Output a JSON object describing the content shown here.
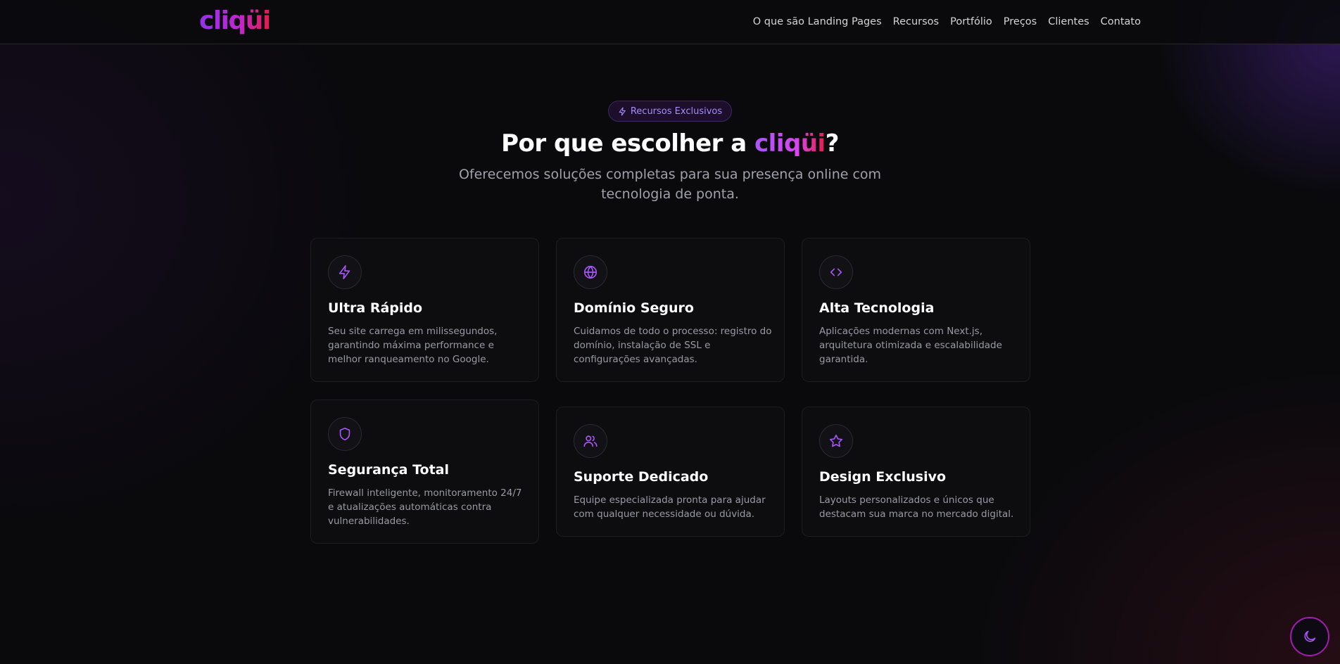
{
  "header": {
    "logo": "cliqüi",
    "nav": [
      "O que são Landing Pages",
      "Recursos",
      "Portfólio",
      "Preços",
      "Clientes",
      "Contato"
    ]
  },
  "hero": {
    "badge": "Recursos Exclusivos",
    "title_prefix": "Por que escolher a ",
    "title_brand": "cliqüi",
    "title_suffix": "?",
    "subtitle": "Oferecemos soluções completas para sua presença online com tecnologia de ponta."
  },
  "features": [
    {
      "icon": "lightning-icon",
      "title": "Ultra Rápido",
      "description": "Seu site carrega em milissegundos, garantindo máxima performance e melhor ranqueamento no Google."
    },
    {
      "icon": "globe-icon",
      "title": "Domínio Seguro",
      "description": "Cuidamos de todo o processo: registro do domínio, instalação de SSL e configurações avançadas."
    },
    {
      "icon": "code-icon",
      "title": "Alta Tecnologia",
      "description": "Aplicações modernas com Next.js, arquitetura otimizada e escalabilidade garantida."
    },
    {
      "icon": "shield-icon",
      "title": "Segurança Total",
      "description": "Firewall inteligente, monitoramento 24/7 e atualizações automáticas contra vulnerabilidades."
    },
    {
      "icon": "users-icon",
      "title": "Suporte Dedicado",
      "description": "Equipe especializada pronta para ajudar com qualquer necessidade ou dúvida."
    },
    {
      "icon": "star-icon",
      "title": "Design Exclusivo",
      "description": "Layouts personalizados e únicos que destacam sua marca no mercado digital."
    }
  ],
  "theme_toggle": {
    "icon": "moon-icon"
  },
  "colors": {
    "accent": "#a855f7",
    "brand_gradient_start": "#9333ea",
    "brand_gradient_end": "#e11d48",
    "background": "#0a0a0d"
  }
}
